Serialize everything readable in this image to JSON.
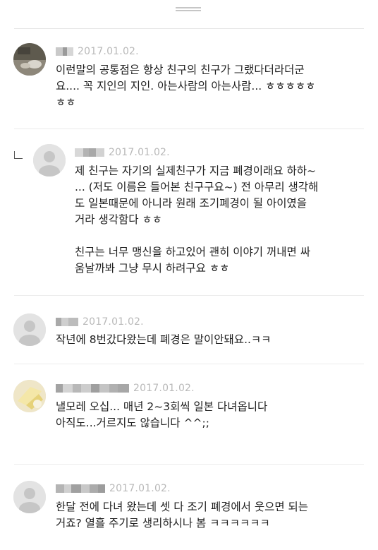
{
  "colors": {
    "date": "#b9b9b9",
    "text": "#1e1e1e",
    "divider": "#ececec"
  },
  "comments": [
    {
      "date": "2017.01.02.",
      "text": [
        "이런말의 공통점은 항상 친구의 친구가 그랬다더라더군",
        "요.... 꼭 지인의 지인. 아는사람의 아는사람... ㅎㅎㅎㅎㅎ",
        "ㅎㅎ"
      ]
    },
    {
      "reply": true,
      "date": "2017.01.02.",
      "text": [
        "제 친구는 자기의 실제친구가 지금 폐경이래요 하하~",
        "... (저도 이름은 들어본 친구구요~) 전 아무리 생각해",
        "도 일본때문에 아니라 원래 조기폐경이 될 아이였을",
        "거라 생각함다 ㅎㅎ"
      ],
      "text2": [
        "친구는 너무 맹신을 하고있어 괜히 이야기 꺼내면 싸",
        "움날까봐 그냥 무시 하려구요 ㅎㅎ"
      ]
    },
    {
      "date": "2017.01.02.",
      "text": [
        "작년에 8번갔다왔는데 폐경은 말이안돼요..ㅋㅋ"
      ]
    },
    {
      "date": "2017.01.02.",
      "text": [
        "낼모레 오십... 매년 2~3회씩 일본  다녀옵니다",
        "아직도...거르지도 않습니다 ^^;;"
      ]
    },
    {
      "date": "2017.01.02.",
      "text": [
        "한달 전에 다녀 왔는데 셋 다 조기 폐경에서 웃으면 되는",
        "거죠? 열흘 주기로 생리하시나 봄 ㅋㅋㅋㅋㅋㅋ"
      ]
    }
  ]
}
